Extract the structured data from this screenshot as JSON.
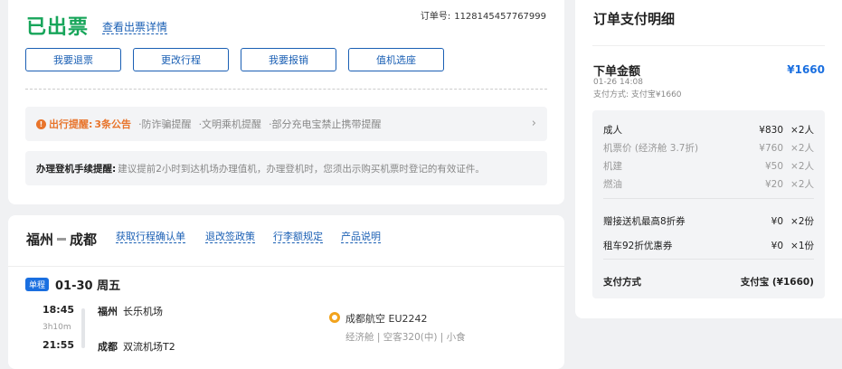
{
  "status": {
    "title": "已出票",
    "detail_link": "查看出票详情",
    "order_label": "订单号:",
    "order_no": "1128145457767999"
  },
  "actions": [
    "我要退票",
    "更改行程",
    "我要报销",
    "值机选座"
  ],
  "notice": {
    "label": "出行提醒:",
    "count": "3条公告",
    "items": [
      "·防诈骗提醒",
      "·文明乘机提醒",
      "·部分充电宝禁止携带提醒"
    ]
  },
  "checkin": {
    "label": "办理登机手续提醒:",
    "text": "建议提前2小时到达机场办理值机，办理登机时，您须出示购买机票时登记的有效证件。"
  },
  "trip": {
    "from": "福州",
    "to": "成都",
    "links": [
      "获取行程确认单",
      "退改签政策",
      "行李额规定",
      "产品说明"
    ],
    "leg_badge": "单程",
    "date": "01-30 周五",
    "dep_time": "18:45",
    "duration": "3h10m",
    "arr_time": "21:55",
    "dep_city": "福州",
    "dep_airport": "长乐机场",
    "arr_city": "成都",
    "arr_airport": "双流机场T2",
    "airline": "成都航空 EU2242",
    "cabin": "经济舱 | 空客320(中) | 小食"
  },
  "payment": {
    "title": "订单支付明细",
    "total_label": "下单金额",
    "total_amount": "¥1660",
    "order_time": "01-26 14:08",
    "method_line": "支付方式: 支付宝¥1660",
    "rows": [
      {
        "label": "成人",
        "amount": "¥830",
        "qty": "×2人",
        "style": "main"
      },
      {
        "label": "机票价 (经济舱 3.7折)",
        "amount": "¥760",
        "qty": "×2人",
        "style": "sub"
      },
      {
        "label": "机建",
        "amount": "¥50",
        "qty": "×2人",
        "style": "sub"
      },
      {
        "label": "燃油",
        "amount": "¥20",
        "qty": "×2人",
        "style": "sub"
      }
    ],
    "coupons": [
      {
        "label": "赠接送机最高8折券",
        "amount": "¥0",
        "qty": "×2份"
      },
      {
        "label": "租车92折优惠券",
        "amount": "¥0",
        "qty": "×1份"
      }
    ],
    "pay_method_label": "支付方式",
    "pay_method_value": "支付宝 (¥1660)"
  },
  "colors": {
    "success": "#17a55a",
    "link": "#1a5fb4",
    "accent": "#1a6fe0",
    "warning": "#e8742b"
  }
}
